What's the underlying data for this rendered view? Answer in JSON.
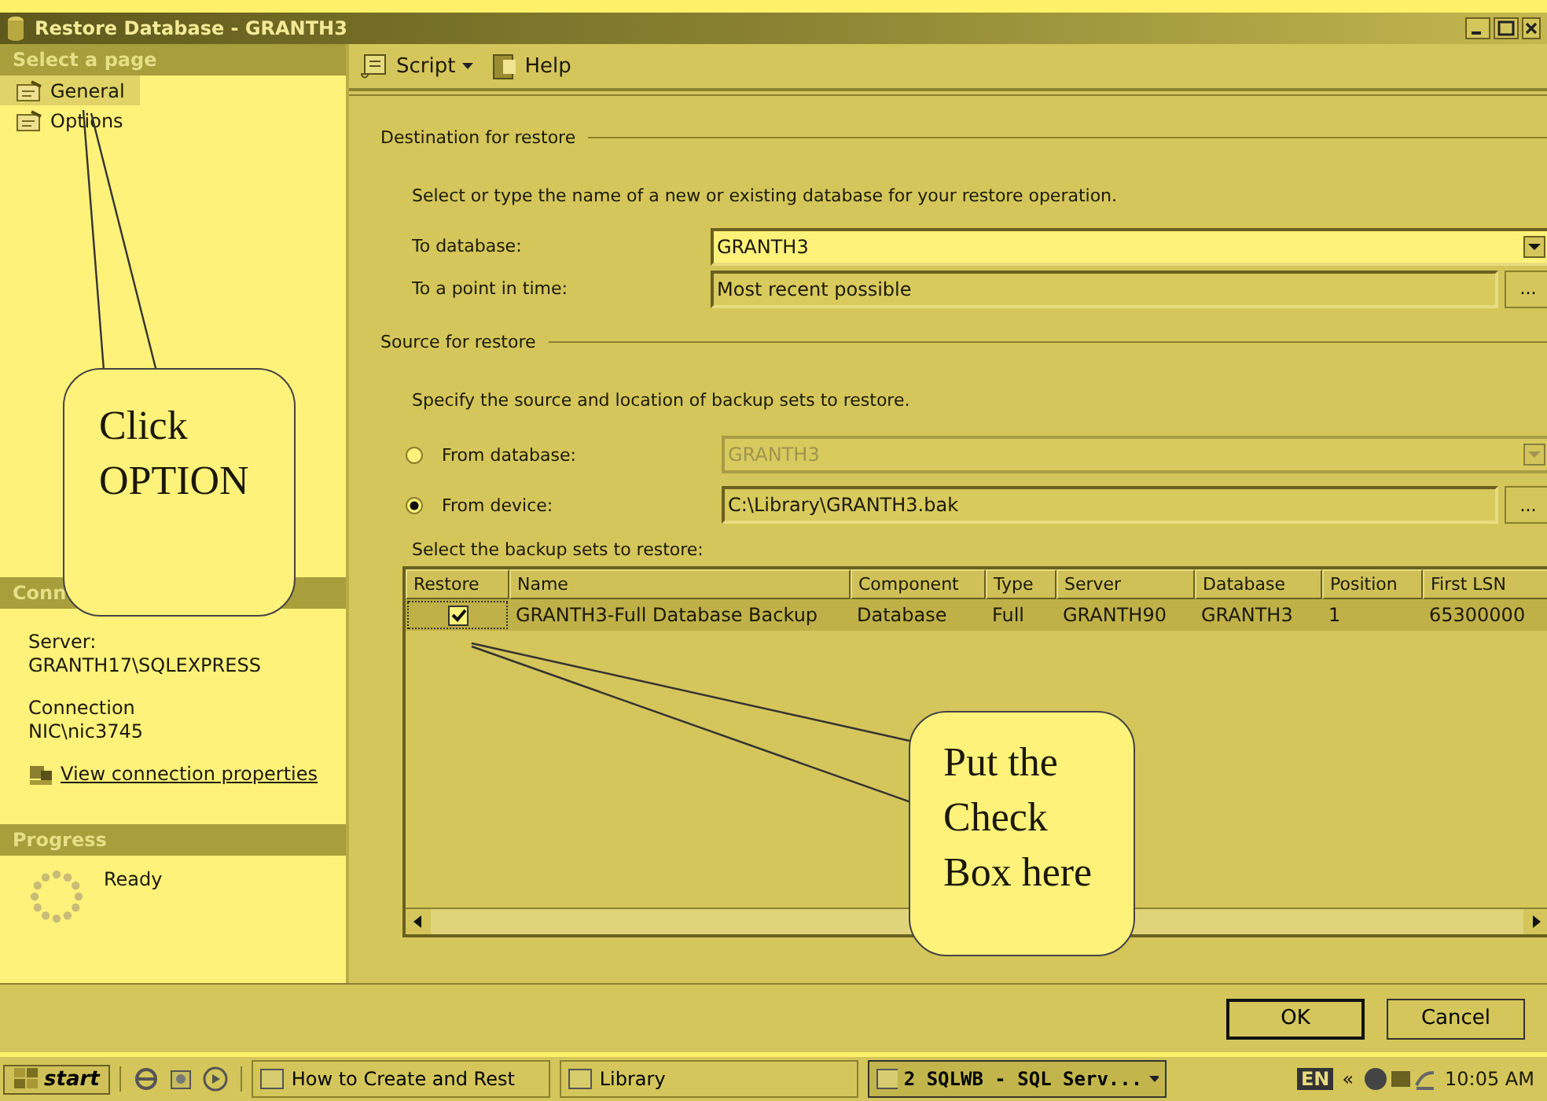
{
  "window": {
    "title": "Restore Database - GRANTH3"
  },
  "sidebar": {
    "header": "Select a page",
    "pages": [
      {
        "label": "General",
        "selected": true
      },
      {
        "label": "Options",
        "selected": false
      }
    ],
    "connection": {
      "header": "Conn",
      "server_label": "Server:",
      "server": "GRANTH17\\SQLEXPRESS",
      "connection_label": "Connection",
      "connection": "NIC\\nic3745",
      "link": "View connection properties"
    },
    "progress": {
      "header": "Progress",
      "status": "Ready"
    }
  },
  "toolbar": {
    "script": "Script",
    "help": "Help"
  },
  "destination": {
    "header": "Destination for restore",
    "hint": "Select or type the name of a new or existing database for your restore operation.",
    "to_database": {
      "label": "To database:",
      "value": "GRANTH3"
    },
    "point_in_time": {
      "label": "To a point in time:",
      "value": "Most recent possible",
      "browse": "..."
    }
  },
  "source": {
    "header": "Source for restore",
    "hint": "Specify the source and location of backup sets to restore.",
    "options": [
      {
        "label": "From database:",
        "selected": false,
        "disabled": true,
        "kind": "dropdown",
        "value": "GRANTH3"
      },
      {
        "label": "From device:",
        "selected": true,
        "disabled": false,
        "kind": "browse",
        "value": "C:\\Library\\GRANTH3.bak",
        "browse": "..."
      }
    ]
  },
  "backup_sets": {
    "label": "Select the backup sets to restore:",
    "check_column": "Restore",
    "columns": [
      "Name",
      "Component",
      "Type",
      "Server",
      "Database",
      "Position",
      "First LSN"
    ],
    "rows": [
      {
        "checked": true,
        "cells": [
          "GRANTH3-Full Database Backup",
          "Database",
          "Full",
          "GRANTH90",
          "GRANTH3",
          "1",
          "65300000"
        ]
      }
    ]
  },
  "buttons": [
    "OK",
    "Cancel"
  ],
  "callouts": [
    {
      "lines": [
        "Click",
        "OPTION"
      ]
    },
    {
      "lines": [
        "Put the",
        "Check",
        "Box here"
      ]
    }
  ],
  "taskbar": {
    "start": "start",
    "tasks": [
      {
        "label": "How to Create and Rest",
        "selected": false
      },
      {
        "label": "Library",
        "selected": false
      },
      {
        "label": "2 SQLWB - SQL Serv...",
        "selected": true
      }
    ],
    "language": "EN",
    "chevron": "«",
    "clock": "10:05 AM"
  }
}
